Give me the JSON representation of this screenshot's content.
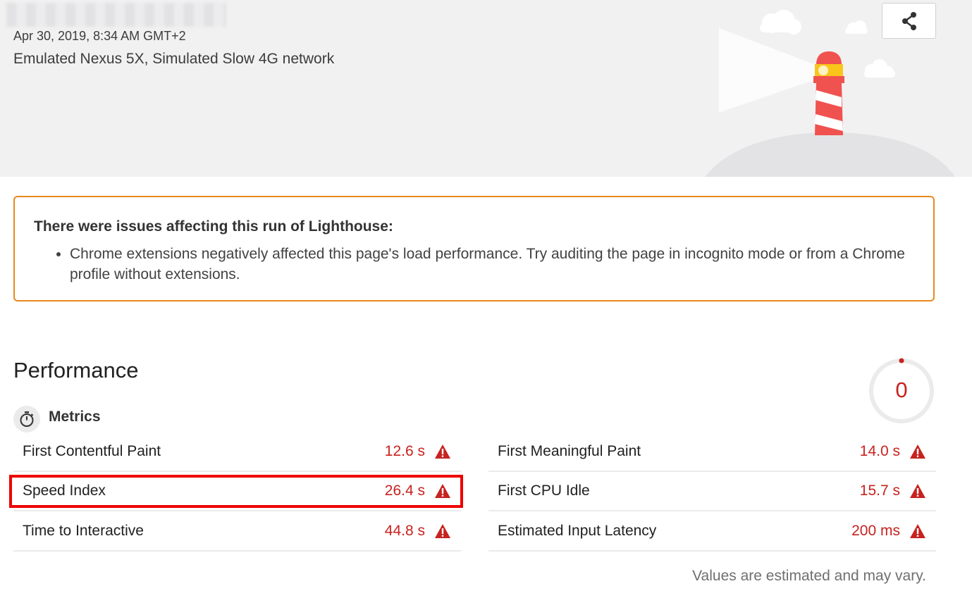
{
  "header": {
    "fetch_time": "Apr 30, 2019, 8:34 AM GMT+2",
    "environment": "Emulated Nexus 5X, Simulated Slow 4G network",
    "share_icon": "share-icon"
  },
  "warnings": {
    "title": "There were issues affecting this run of Lighthouse:",
    "items": [
      "Chrome extensions negatively affected this page's load performance. Try auditing the page in incognito mode or from a Chrome profile without extensions."
    ]
  },
  "performance": {
    "title": "Performance",
    "score": "0",
    "score_color": "#c7221f",
    "metrics_label": "Metrics",
    "metrics_icon": "stopwatch-icon",
    "metrics": [
      {
        "label": "First Contentful Paint",
        "value": "12.6 s",
        "status_icon": "warning-triangle-icon"
      },
      {
        "label": "First Meaningful Paint",
        "value": "14.0 s",
        "status_icon": "warning-triangle-icon"
      },
      {
        "label": "Speed Index",
        "value": "26.4 s",
        "status_icon": "warning-triangle-icon",
        "highlighted": true
      },
      {
        "label": "First CPU Idle",
        "value": "15.7 s",
        "status_icon": "warning-triangle-icon"
      },
      {
        "label": "Time to Interactive",
        "value": "44.8 s",
        "status_icon": "warning-triangle-icon"
      },
      {
        "label": "Estimated Input Latency",
        "value": "200 ms",
        "status_icon": "warning-triangle-icon"
      }
    ],
    "footnote": "Values are estimated and may vary."
  },
  "colors": {
    "fail": "#c7221f",
    "warning_border": "#e8891d",
    "highlight_border": "#ef0000",
    "header_bg": "#f1f1f2"
  }
}
